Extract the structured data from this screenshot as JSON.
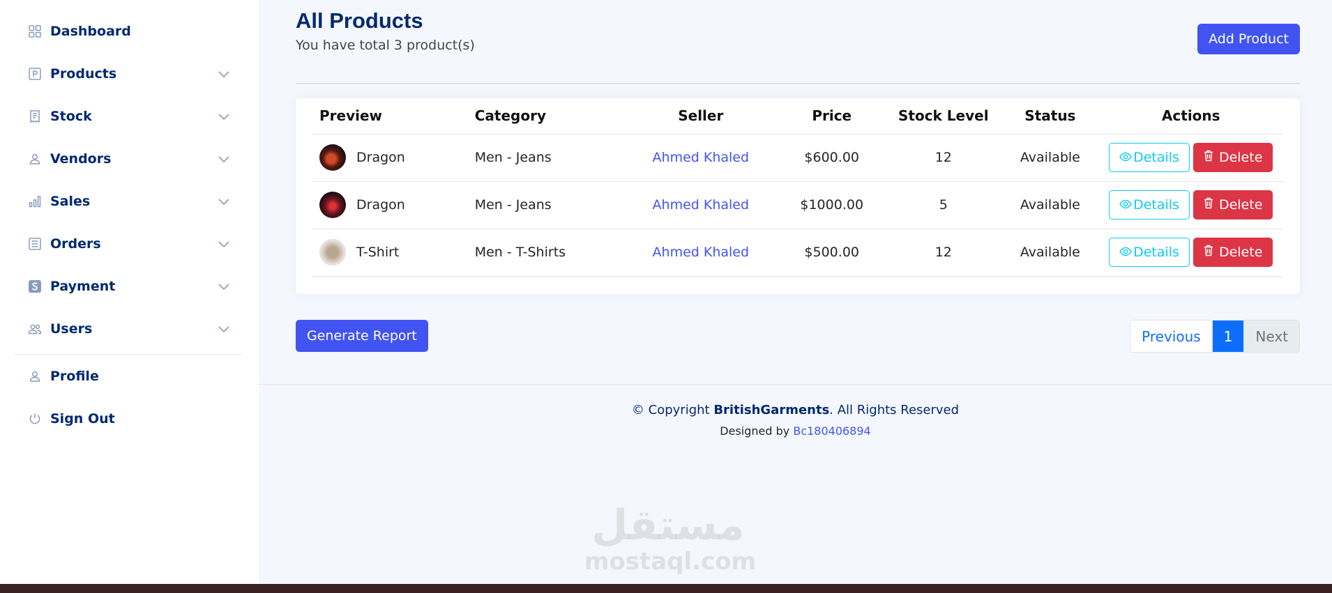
{
  "sidebar": {
    "items": [
      {
        "label": "Dashboard",
        "icon": "grid-icon",
        "has_chevron": false
      },
      {
        "label": "Products",
        "icon": "p-box-icon",
        "has_chevron": true
      },
      {
        "label": "Stock",
        "icon": "receipt-icon",
        "has_chevron": true
      },
      {
        "label": "Vendors",
        "icon": "person-icon",
        "has_chevron": true
      },
      {
        "label": "Sales",
        "icon": "bar-chart-icon",
        "has_chevron": true
      },
      {
        "label": "Orders",
        "icon": "list-box-icon",
        "has_chevron": true
      },
      {
        "label": "Payment",
        "icon": "s-square-icon",
        "has_chevron": true
      },
      {
        "label": "Users",
        "icon": "people-icon",
        "has_chevron": true
      }
    ],
    "bottom_items": [
      {
        "label": "Profile",
        "icon": "person-icon"
      },
      {
        "label": "Sign Out",
        "icon": "power-icon"
      }
    ]
  },
  "header": {
    "title": "All Products",
    "subtitle": "You have total 3 product(s)",
    "add_button": "Add Product"
  },
  "table": {
    "columns": [
      "Preview",
      "Category",
      "Seller",
      "Price",
      "Stock Level",
      "Status",
      "Actions"
    ],
    "rows": [
      {
        "name": "Dragon",
        "category": "Men - Jeans",
        "seller": "Ahmed Khaled",
        "price": "$600.00",
        "stock": "12",
        "status": "Available"
      },
      {
        "name": "Dragon",
        "category": "Men - Jeans",
        "seller": "Ahmed Khaled",
        "price": "$1000.00",
        "stock": "5",
        "status": "Available"
      },
      {
        "name": "T-Shirt",
        "category": "Men - T-Shirts",
        "seller": "Ahmed Khaled",
        "price": "$500.00",
        "stock": "12",
        "status": "Available"
      }
    ],
    "details_label": "Details",
    "delete_label": "Delete"
  },
  "report_button": "Generate Report",
  "pagination": {
    "previous": "Previous",
    "current": "1",
    "next": "Next"
  },
  "footer": {
    "copyright_prefix": "© Copyright ",
    "brand": "BritishGarments",
    "copyright_suffix": ". All Rights Reserved",
    "designed_prefix": "Designed by ",
    "designer": "Bc180406894"
  },
  "watermark": {
    "arabic": "مستقل",
    "latin": "mostaql.com"
  },
  "colors": {
    "primary": "#4154f1",
    "nav_text": "#012970",
    "danger": "#dc3545",
    "info": "#0dcaf0",
    "page_bg": "#f5f7fe"
  }
}
